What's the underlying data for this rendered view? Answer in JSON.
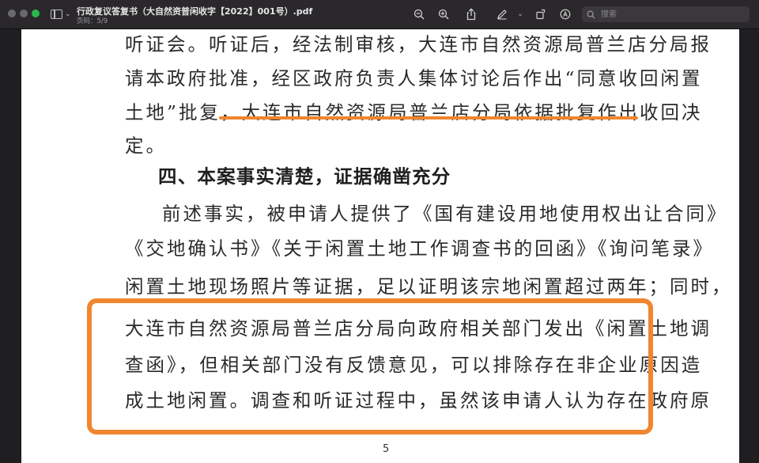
{
  "window": {
    "title": "行政复议答复书（大自然资普闲收字【2022】001号）.pdf",
    "page_indicator": "页码：5/9"
  },
  "toolbar": {
    "icons": [
      "sidebar-icon",
      "zoom-out-icon",
      "zoom-in-icon",
      "share-icon",
      "markup-pen-icon",
      "chevron-down-icon",
      "rotate-icon",
      "annotate-icon",
      "search-icon"
    ],
    "search_placeholder": "搜索"
  },
  "colors": {
    "highlight": "#f0862e",
    "titlebar": "#2a282b",
    "close": "#6a6a6e",
    "maximize": "#2bb84a"
  },
  "document": {
    "lines": [
      "听证会。听证后，经法制审核，大连市自然资源局普兰店分局报",
      "请本政府批准，经区政府负责人集体讨论后作出“同意收回闲置",
      "土地”批复，大连市自然资源局普兰店分局依据批复作出收回决",
      "定。"
    ],
    "heading": "四、本案事实清楚，证据确凿充分",
    "para2": [
      "前述事实，被申请人提供了《国有建设用地使用权出让合同》",
      "《交地确认书》《关于闲置土地工作调查书的回函》《询问笔录》",
      "闲置土地现场照片等证据，足以证明该宗地闲置超过两年；同时，",
      "大连市自然资源局普兰店分局向政府相关部门发出《闲置土地调",
      "查函》，但相关部门没有反馈意见，可以排除存在非企业原因造",
      "成土地闲置。调查和听证过程中，虽然该申请人认为存在政府原"
    ],
    "page_number": "5"
  }
}
